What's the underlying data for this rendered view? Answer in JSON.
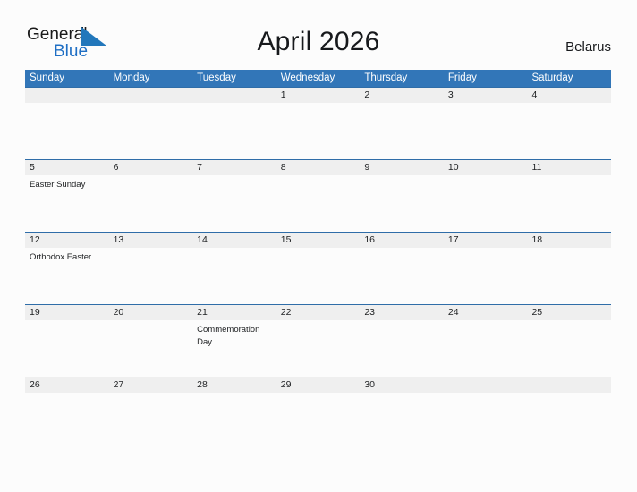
{
  "logo": {
    "word_one": "General",
    "word_two": "Blue",
    "triangle_color": "#2277bb",
    "text_color": "#1a1a1a",
    "blue_color": "#1f6fc4"
  },
  "header": {
    "title": "April 2026",
    "country": "Belarus"
  },
  "theme": {
    "header_blue": "#3276b8",
    "row_divider_blue": "#2f6da8",
    "date_band_gray": "#efefef",
    "page_background": "#fcfcfc"
  },
  "calendar": {
    "weekdays": [
      "Sunday",
      "Monday",
      "Tuesday",
      "Wednesday",
      "Thursday",
      "Friday",
      "Saturday"
    ],
    "weeks": [
      {
        "days": [
          {
            "date": "",
            "event": ""
          },
          {
            "date": "",
            "event": ""
          },
          {
            "date": "",
            "event": ""
          },
          {
            "date": "1",
            "event": ""
          },
          {
            "date": "2",
            "event": ""
          },
          {
            "date": "3",
            "event": ""
          },
          {
            "date": "4",
            "event": ""
          }
        ]
      },
      {
        "days": [
          {
            "date": "5",
            "event": "Easter Sunday"
          },
          {
            "date": "6",
            "event": ""
          },
          {
            "date": "7",
            "event": ""
          },
          {
            "date": "8",
            "event": ""
          },
          {
            "date": "9",
            "event": ""
          },
          {
            "date": "10",
            "event": ""
          },
          {
            "date": "11",
            "event": ""
          }
        ]
      },
      {
        "days": [
          {
            "date": "12",
            "event": "Orthodox Easter"
          },
          {
            "date": "13",
            "event": ""
          },
          {
            "date": "14",
            "event": ""
          },
          {
            "date": "15",
            "event": ""
          },
          {
            "date": "16",
            "event": ""
          },
          {
            "date": "17",
            "event": ""
          },
          {
            "date": "18",
            "event": ""
          }
        ]
      },
      {
        "days": [
          {
            "date": "19",
            "event": ""
          },
          {
            "date": "20",
            "event": ""
          },
          {
            "date": "21",
            "event": "Commemoration Day"
          },
          {
            "date": "22",
            "event": ""
          },
          {
            "date": "23",
            "event": ""
          },
          {
            "date": "24",
            "event": ""
          },
          {
            "date": "25",
            "event": ""
          }
        ]
      },
      {
        "days": [
          {
            "date": "26",
            "event": ""
          },
          {
            "date": "27",
            "event": ""
          },
          {
            "date": "28",
            "event": ""
          },
          {
            "date": "29",
            "event": ""
          },
          {
            "date": "30",
            "event": ""
          },
          {
            "date": "",
            "event": ""
          },
          {
            "date": "",
            "event": ""
          }
        ]
      }
    ]
  }
}
